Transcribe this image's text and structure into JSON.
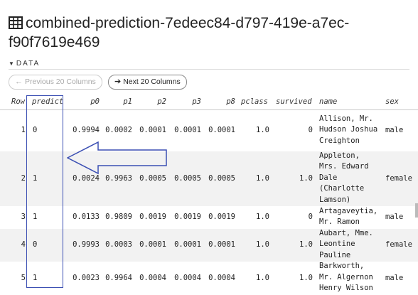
{
  "title": "combined-prediction-7edeec84-d797-419e-a7ec-f90f7619e469",
  "title_icon": "table-icon",
  "section": "DATA",
  "buttons": {
    "prev": "Previous 20 Columns",
    "next": "Next 20 Columns"
  },
  "columns": [
    "Row",
    "predict",
    "p0",
    "p1",
    "p2",
    "p3",
    "p8",
    "pclass",
    "survived",
    "name",
    "sex"
  ],
  "rows": [
    {
      "row": "1",
      "predict": "0",
      "p0": "0.9994",
      "p1": "0.0002",
      "p2": "0.0001",
      "p3": "0.0001",
      "p8": "0.0001",
      "pclass": "1.0",
      "survived": "0",
      "name": [
        "Allison, Mr.",
        "Hudson Joshua",
        "Creighton"
      ],
      "sex": "male"
    },
    {
      "row": "2",
      "predict": "1",
      "p0": "0.0024",
      "p1": "0.9963",
      "p2": "0.0005",
      "p3": "0.0005",
      "p8": "0.0005",
      "pclass": "1.0",
      "survived": "1.0",
      "name": [
        "Appleton,",
        "Mrs. Edward",
        "Dale",
        "(Charlotte",
        "Lamson)"
      ],
      "sex": "female"
    },
    {
      "row": "3",
      "predict": "1",
      "p0": "0.0133",
      "p1": "0.9809",
      "p2": "0.0019",
      "p3": "0.0019",
      "p8": "0.0019",
      "pclass": "1.0",
      "survived": "0",
      "name": [
        "Artagaveytia,",
        "Mr. Ramon"
      ],
      "sex": "male"
    },
    {
      "row": "4",
      "predict": "0",
      "p0": "0.9993",
      "p1": "0.0003",
      "p2": "0.0001",
      "p3": "0.0001",
      "p8": "0.0001",
      "pclass": "1.0",
      "survived": "1.0",
      "name": [
        "Aubart, Mme.",
        "Leontine",
        "Pauline"
      ],
      "sex": "female"
    },
    {
      "row": "5",
      "predict": "1",
      "p0": "0.0023",
      "p1": "0.9964",
      "p2": "0.0004",
      "p3": "0.0004",
      "p8": "0.0004",
      "pclass": "1.0",
      "survived": "1.0",
      "name": [
        "Barkworth,",
        "Mr. Algernon",
        "Henry Wilson"
      ],
      "sex": "male"
    }
  ],
  "colors": {
    "highlight": "#3b4fb3",
    "row_alt": "#f2f2f2"
  }
}
